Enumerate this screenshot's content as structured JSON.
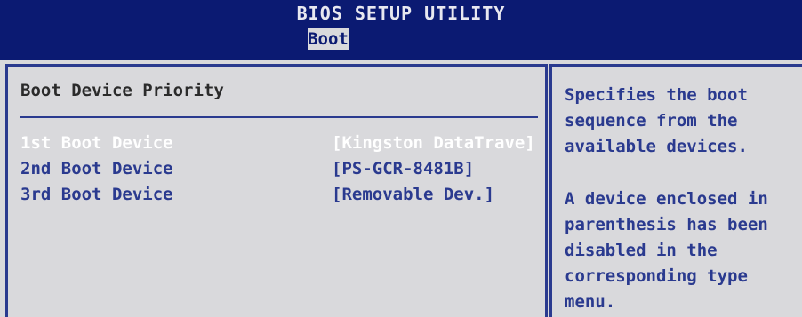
{
  "header": {
    "title": "BIOS SETUP UTILITY"
  },
  "tabs": [
    {
      "label": "Boot",
      "active": true
    }
  ],
  "main": {
    "section_title": "Boot Device Priority",
    "items": [
      {
        "label": "1st Boot Device",
        "value": "[Kingston DataTrave]",
        "selected": true
      },
      {
        "label": "2nd Boot Device",
        "value": "[PS-GCR-8481B]",
        "selected": false
      },
      {
        "label": "3rd Boot Device",
        "value": "[Removable Dev.]",
        "selected": false
      }
    ]
  },
  "help": {
    "paragraph1": "Specifies the boot sequence from the available devices.",
    "paragraph2": "A device enclosed in parenthesis has been disabled in the corresponding type menu."
  },
  "colors": {
    "header_bg": "#0b1a72",
    "panel_bg": "#d9d9dc",
    "text_blue": "#2a3a8f",
    "selected_text": "#ffffff"
  }
}
